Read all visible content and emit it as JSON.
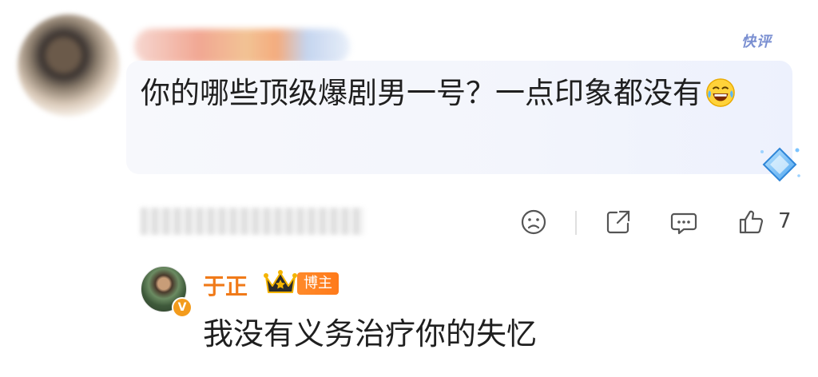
{
  "comment": {
    "author_blurred": true,
    "badge": "快评",
    "text": "你的哪些顶级爆剧男一号？一点印象都没有",
    "emoji_icon": "laughing-tears-emoji",
    "likes": "7",
    "actions": [
      "dislike-face-icon",
      "share-icon",
      "comment-icon",
      "like-thumb-icon"
    ]
  },
  "reply": {
    "author": "于正",
    "role_tag": "博主",
    "verified_mark": "V",
    "text": "我没有义务治疗你的失忆"
  },
  "colors": {
    "accent_orange": "#f07a19",
    "badge_blue": "#7a8fd1",
    "bubble_bg": "#f3f5fc"
  }
}
